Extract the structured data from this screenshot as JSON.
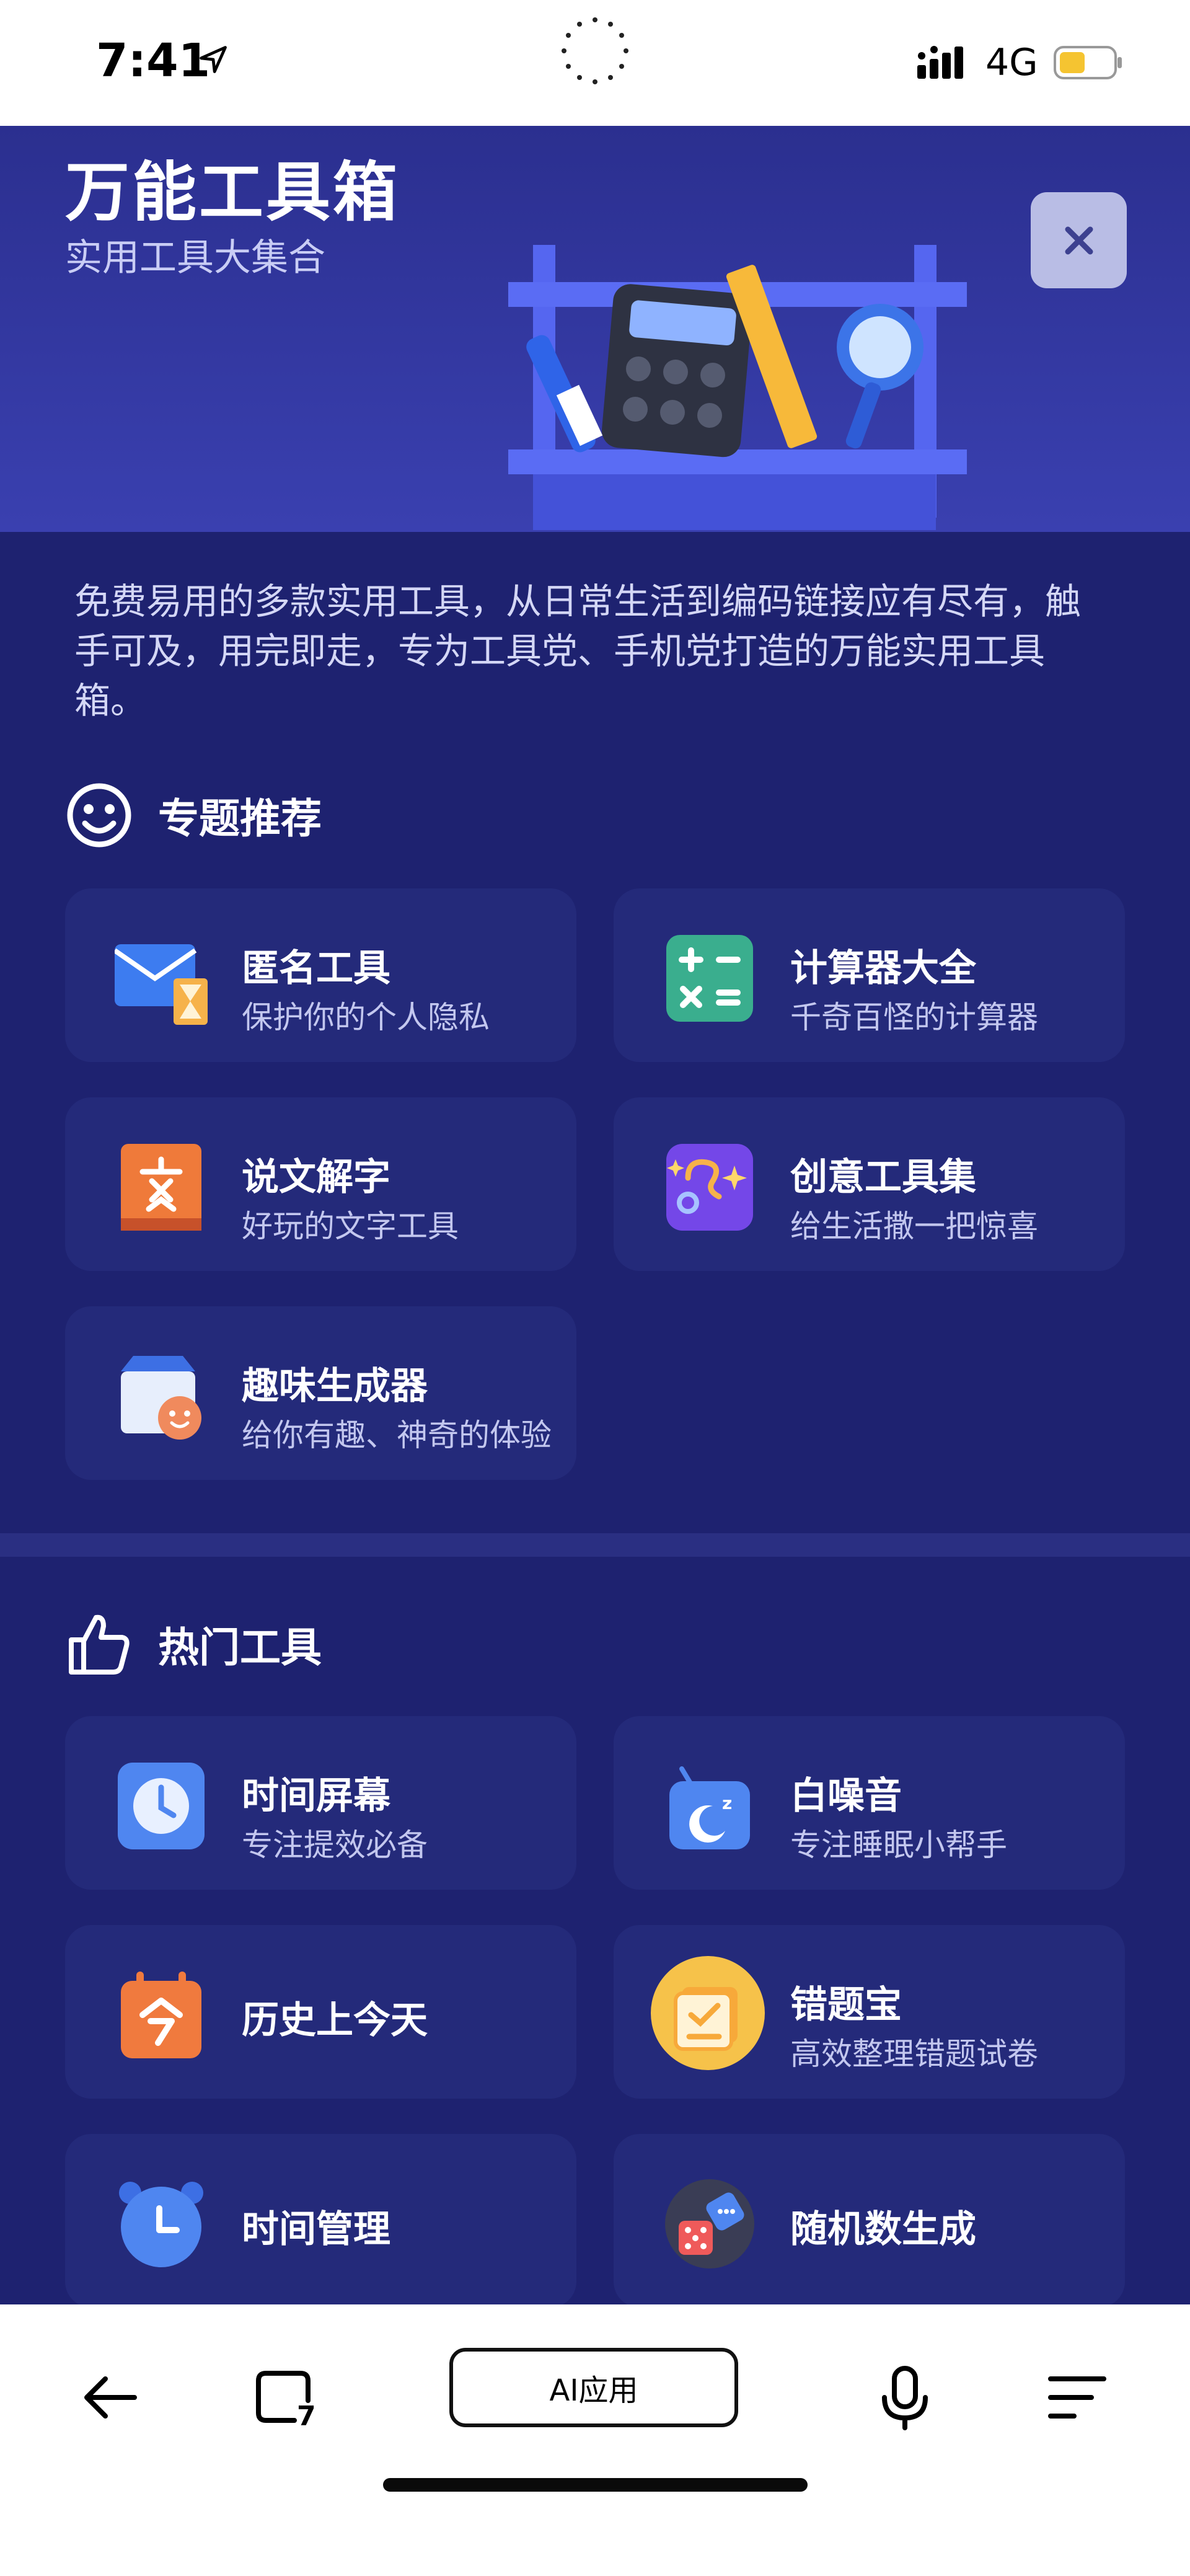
{
  "status": {
    "time": "7:41",
    "network": "4G"
  },
  "header": {
    "title": "万能工具箱",
    "subtitle": "实用工具大集合"
  },
  "intro": "免费易用的多款实用工具，从日常生活到编码链接应有尽有，触手可及，用完即走，专为工具党、手机党打造的万能实用工具箱。",
  "sections": {
    "featured": "专题推荐",
    "hot": "热门工具"
  },
  "featured": [
    {
      "title": "匿名工具",
      "desc": "保护你的个人隐私",
      "icon": "envelope-hourglass-icon"
    },
    {
      "title": "计算器大全",
      "desc": "千奇百怪的计算器",
      "icon": "calculator-icon"
    },
    {
      "title": "说文解字",
      "desc": "好玩的文字工具",
      "icon": "book-character-icon"
    },
    {
      "title": "创意工具集",
      "desc": "给生活撒一把惊喜",
      "icon": "creative-sparkle-icon"
    },
    {
      "title": "趣味生成器",
      "desc": "给你有趣、神奇的体验",
      "icon": "smiley-box-icon"
    }
  ],
  "hot": [
    {
      "title": "时间屏幕",
      "desc": "专注提效必备",
      "icon": "clock-icon"
    },
    {
      "title": "白噪音",
      "desc": "专注睡眠小帮手",
      "icon": "radio-moon-icon"
    },
    {
      "title": "历史上今天",
      "desc": "",
      "icon": "calendar-today-icon"
    },
    {
      "title": "错题宝",
      "desc": "高效整理错题试卷",
      "icon": "error-book-icon"
    },
    {
      "title": "时间管理",
      "desc": "",
      "icon": "alarm-clock-icon"
    },
    {
      "title": "随机数生成",
      "desc": "",
      "icon": "dice-icon"
    }
  ],
  "bottom": {
    "ai_label": "AI应用"
  },
  "colors": {
    "background": "#1e2270",
    "card": "#242a7a",
    "header": "#3a40b0"
  }
}
